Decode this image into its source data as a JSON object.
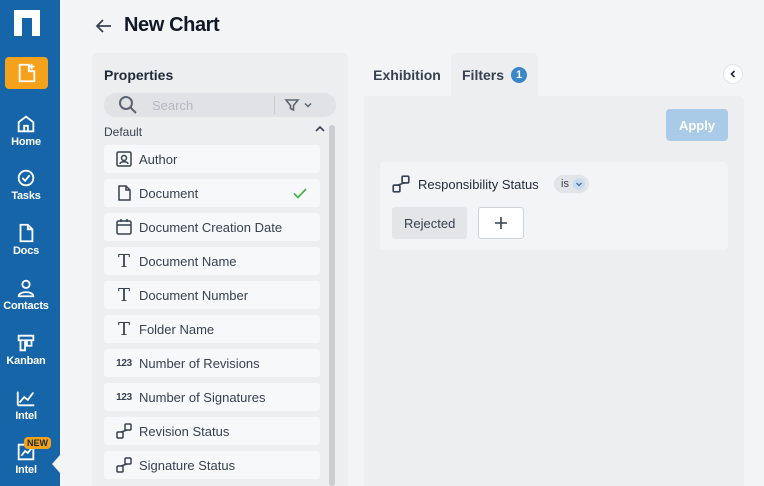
{
  "nav": {
    "items": [
      {
        "label": "Home",
        "icon": "home-icon"
      },
      {
        "label": "Tasks",
        "icon": "check-circle-icon"
      },
      {
        "label": "Docs",
        "icon": "document-icon"
      },
      {
        "label": "Contacts",
        "icon": "person-icon"
      },
      {
        "label": "Kanban",
        "icon": "kanban-icon"
      },
      {
        "label": "Intel",
        "icon": "chart-line-icon"
      },
      {
        "label": "Intel",
        "icon": "chart-edit-icon"
      }
    ],
    "new_badge": "NEW"
  },
  "header": {
    "title": "New Chart"
  },
  "properties": {
    "title": "Properties",
    "search_placeholder": "Search",
    "group_label": "Default",
    "items": [
      {
        "name": "Author",
        "icon": "user-badge-icon",
        "checked": false
      },
      {
        "name": "Document",
        "icon": "file-icon",
        "checked": true
      },
      {
        "name": "Document Creation Date",
        "icon": "calendar-icon",
        "checked": false
      },
      {
        "name": "Document Name",
        "icon": "text-type-icon",
        "checked": false
      },
      {
        "name": "Document Number",
        "icon": "text-type-icon",
        "checked": false
      },
      {
        "name": "Folder Name",
        "icon": "text-type-icon",
        "checked": false
      },
      {
        "name": "Number of Revisions",
        "icon": "number-icon",
        "icon_text": "123",
        "checked": false
      },
      {
        "name": "Number of Signatures",
        "icon": "number-icon",
        "icon_text": "123",
        "checked": false
      },
      {
        "name": "Revision Status",
        "icon": "status-icon",
        "checked": false
      },
      {
        "name": "Signature Status",
        "icon": "status-icon",
        "checked": false
      }
    ]
  },
  "tabs": {
    "exhibition": "Exhibition",
    "filters": "Filters",
    "filters_count": "1"
  },
  "filters": {
    "apply_label": "Apply",
    "items": [
      {
        "property": "Responsibility Status",
        "operator": "is",
        "value": "Rejected"
      }
    ]
  },
  "colors": {
    "nav_bg": "#1565a8",
    "accent_orange": "#f4a11c",
    "apply_disabled": "#a9cbe8",
    "badge_blue": "#3a86c8",
    "check_green": "#4caf50"
  }
}
